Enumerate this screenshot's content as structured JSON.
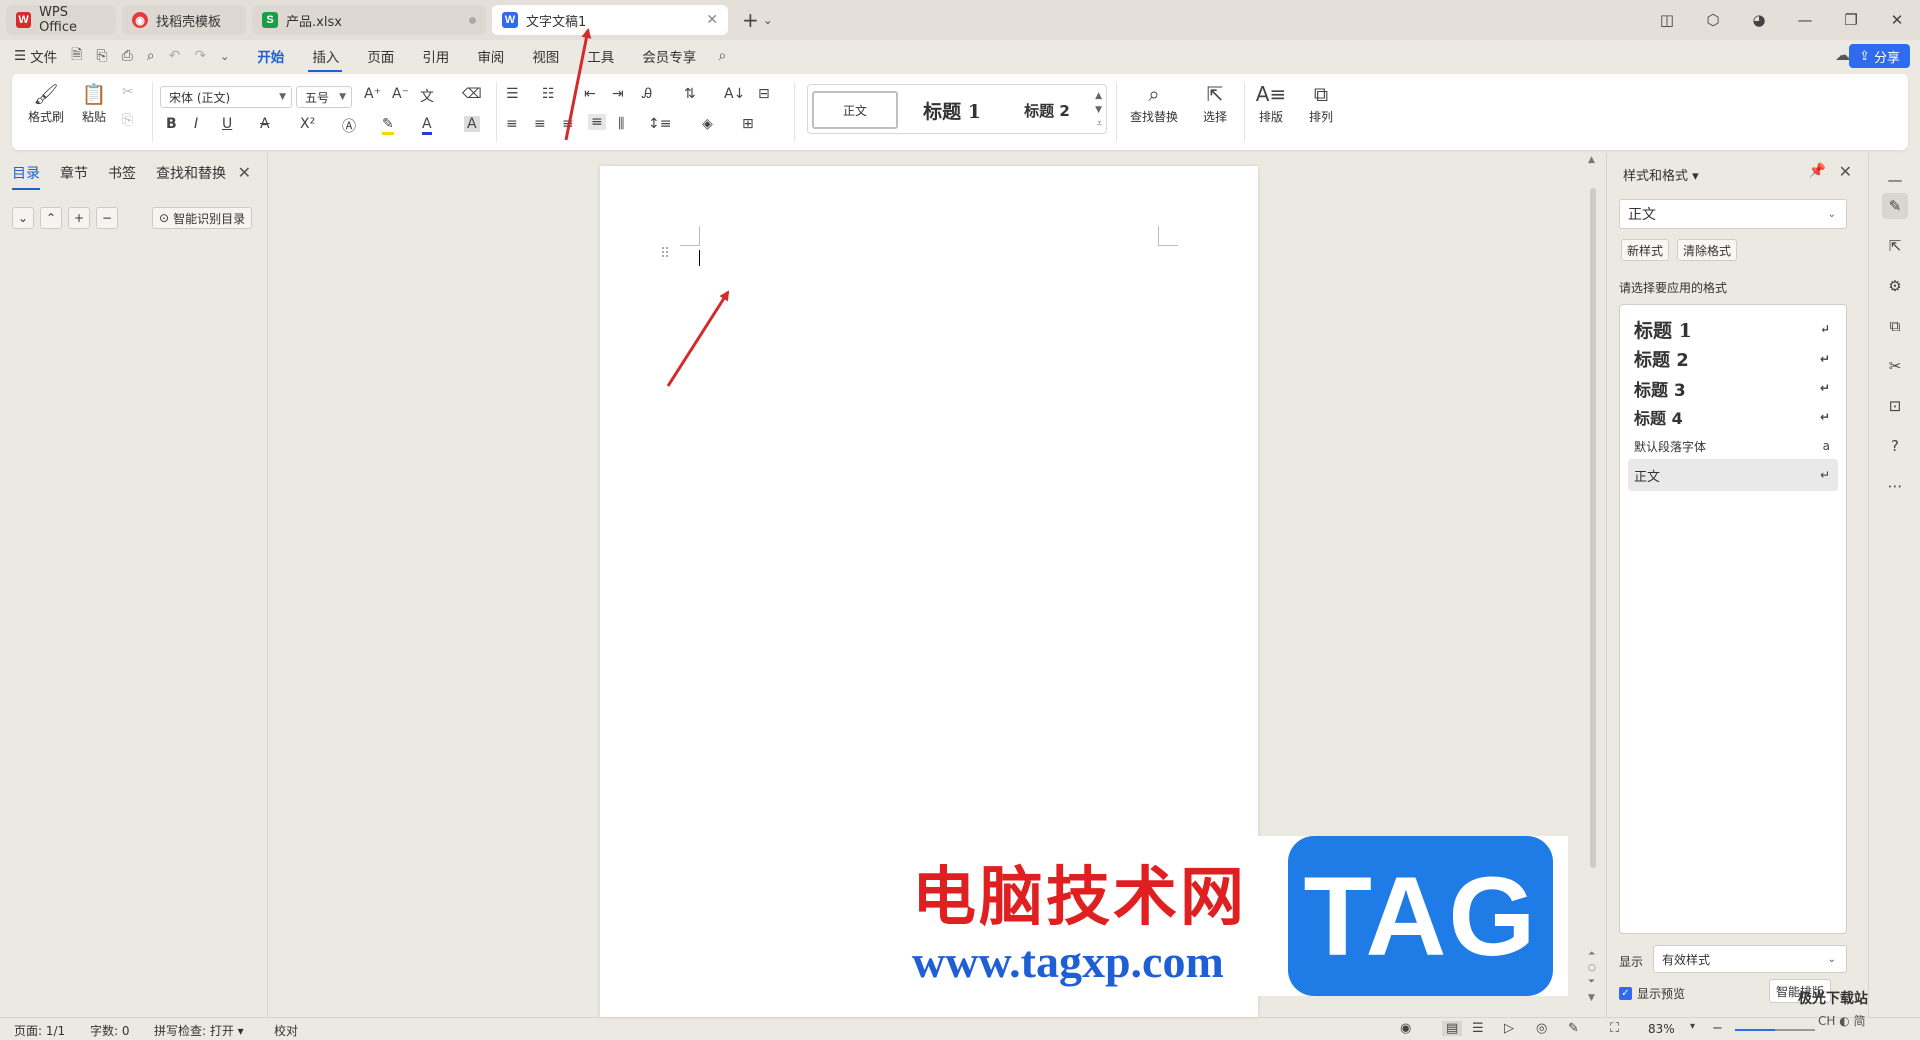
{
  "tabs": [
    {
      "label": "WPS Office",
      "logo": "W",
      "logo_color": "#d92b2b",
      "active": false
    },
    {
      "label": "找稻壳模板",
      "logo": "◉",
      "logo_color": "#e43c3c",
      "active": false
    },
    {
      "label": "产品.xlsx",
      "logo": "S",
      "logo_color": "#1b9e4b",
      "active": false
    },
    {
      "label": "文字文稿1",
      "logo": "W",
      "logo_color": "#2f6bef",
      "active": true
    }
  ],
  "menu": {
    "file": "文件",
    "tabs": [
      "开始",
      "插入",
      "页面",
      "引用",
      "审阅",
      "视图",
      "工具",
      "会员专享"
    ],
    "active_tab": "开始",
    "share": "分享"
  },
  "ribbon": {
    "format_painter": "格式刷",
    "paste": "粘贴",
    "font_name": "宋体 (正文)",
    "font_size": "五号",
    "styles": [
      "正文",
      "标题 1",
      "标题 2"
    ],
    "find_replace": "查找替换",
    "select": "选择",
    "layout": "排版",
    "arrange": "排列"
  },
  "nav_panel": {
    "tabs": [
      "目录",
      "章节",
      "书签",
      "查找和替换"
    ],
    "active_tab": "目录",
    "smart_toc": "智能识别目录"
  },
  "styles_panel": {
    "title": "样式和格式",
    "current_style": "正文",
    "new_style": "新样式",
    "clear_format": "清除格式",
    "hint": "请选择要应用的格式",
    "items": [
      {
        "label": "标题  1",
        "kind": "h1"
      },
      {
        "label": "标题  2",
        "kind": "h2"
      },
      {
        "label": "标题  3",
        "kind": "h3"
      },
      {
        "label": "标题 4",
        "kind": "h4"
      },
      {
        "label": "默认段落字体",
        "kind": "char"
      },
      {
        "label": "正文",
        "kind": "body",
        "selected": true
      }
    ],
    "show_label": "显示",
    "show_value": "有效样式",
    "show_preview": "显示预览",
    "smart_layout": "智能排版"
  },
  "status": {
    "page": "页面: 1/1",
    "words": "字数: 0",
    "spell": "拼写检查: 打开",
    "proof": "校对",
    "zoom": "83%",
    "zoom_level": 0.5
  },
  "watermark": {
    "cn": "电脑技术网",
    "url": "www.tagxp.com",
    "tag": "TAG",
    "corner_top": "极光下载站",
    "corner_bottom": "CH ◐ 简"
  },
  "colors": {
    "accent": "#1f5fd6",
    "share": "#2f6bef",
    "arrow": "#d42a2a",
    "watermark_red": "#e02020",
    "watermark_blue": "#1f7be6"
  }
}
